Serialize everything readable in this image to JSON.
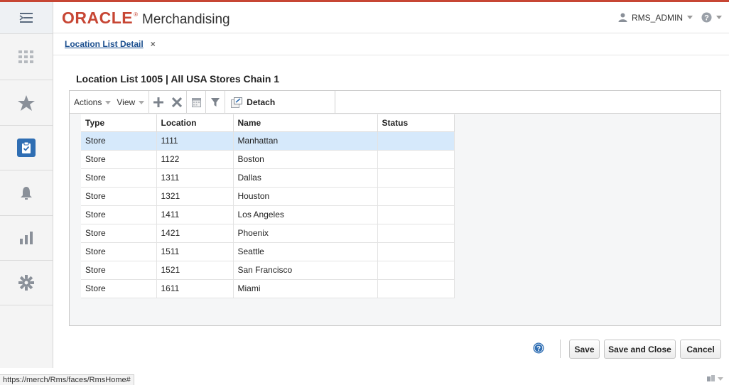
{
  "header": {
    "brand": "ORACLE",
    "brand_mark": "®",
    "product": "Merchandising",
    "user": "RMS_ADMIN"
  },
  "rail": {
    "items": [
      {
        "icon": "menu-icon"
      },
      {
        "icon": "grid-icon"
      },
      {
        "icon": "star-icon"
      },
      {
        "icon": "clipboard-check-icon",
        "active": true
      },
      {
        "icon": "bell-icon"
      },
      {
        "icon": "bar-chart-icon"
      },
      {
        "icon": "gear-icon"
      }
    ]
  },
  "tabs": [
    {
      "label": "Location List Detail",
      "close": "×"
    }
  ],
  "page": {
    "title": "Location List  1005  |  All USA Stores Chain 1"
  },
  "toolbar": {
    "actions_label": "Actions",
    "view_label": "View",
    "detach_label": "Detach"
  },
  "table": {
    "columns": [
      "Type",
      "Location",
      "Name",
      "Status"
    ],
    "rows": [
      {
        "type": "Store",
        "location": "1111",
        "name": "Manhattan",
        "status": ""
      },
      {
        "type": "Store",
        "location": "1122",
        "name": "Boston",
        "status": ""
      },
      {
        "type": "Store",
        "location": "1311",
        "name": "Dallas",
        "status": ""
      },
      {
        "type": "Store",
        "location": "1321",
        "name": "Houston",
        "status": ""
      },
      {
        "type": "Store",
        "location": "1411",
        "name": "Los Angeles",
        "status": ""
      },
      {
        "type": "Store",
        "location": "1421",
        "name": "Phoenix",
        "status": ""
      },
      {
        "type": "Store",
        "location": "1511",
        "name": "Seattle",
        "status": ""
      },
      {
        "type": "Store",
        "location": "1521",
        "name": "San Francisco",
        "status": ""
      },
      {
        "type": "Store",
        "location": "1611",
        "name": "Miami",
        "status": ""
      }
    ]
  },
  "footer": {
    "save": "Save",
    "save_close": "Save and Close",
    "cancel": "Cancel"
  },
  "statusbar": {
    "url": "https://merch/Rms/faces/RmsHome#"
  },
  "colors": {
    "oracle_red": "#c74634",
    "active_blue": "#2f6eb3",
    "selected_row": "#d6e9fb",
    "help_blue": "#2f6eb3"
  }
}
